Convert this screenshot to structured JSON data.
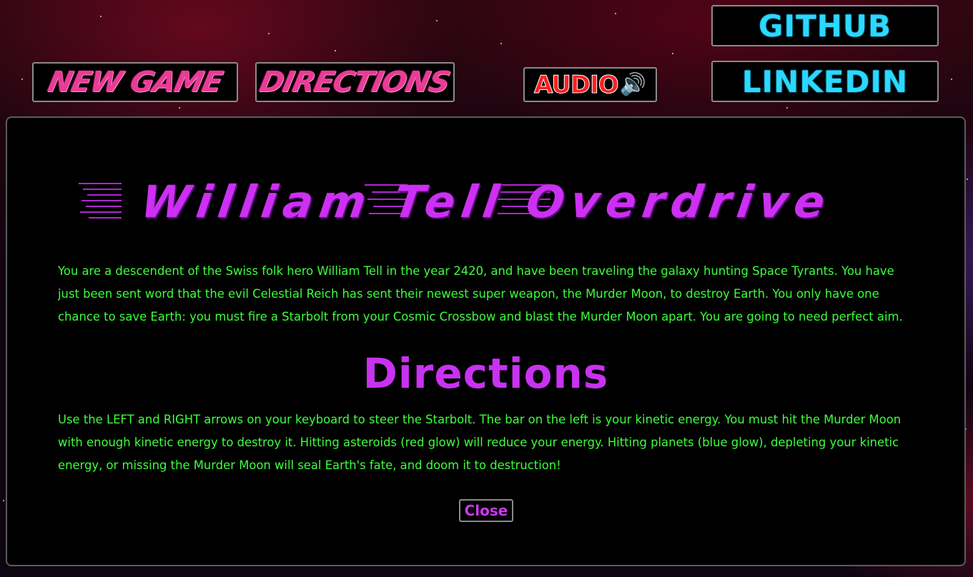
{
  "nav": {
    "new_game_label": "NEW GAME",
    "directions_label": "DIRECTIONS",
    "audio_label": "AUDIO",
    "audio_icon": "speaker-icon",
    "github_label": "GITHUB",
    "linkedin_label": "LINKEDIN"
  },
  "modal": {
    "title": "William Tell Overdrive",
    "story": "You are a descendent of the Swiss folk hero William Tell in the year 2420, and have been traveling the galaxy hunting Space Tyrants. You have just been sent word that the evil Celestial Reich has sent their newest super weapon, the Murder Moon, to destroy Earth. You only have one chance to save Earth: you must fire a Starbolt from your Cosmic Crossbow and blast the Murder Moon apart. You are going to need perfect aim.",
    "directions_heading": "Directions",
    "directions_text": "Use the LEFT and RIGHT arrows on your keyboard to steer the Starbolt. The bar on the left is your kinetic energy. You must hit the Murder Moon with enough kinetic energy to destroy it. Hitting asteroids (red glow) will reduce your energy. Hitting planets (blue glow), depleting your kinetic energy, or missing the Murder Moon will seal Earth's fate, and doom it to destruction!",
    "close_label": "Close"
  },
  "colors": {
    "title": "#cc30f2",
    "body_text": "#3cff3c",
    "pink_buttons": "#e83c97",
    "cyan_buttons": "#2bd8ff",
    "audio": "#ff1f1f"
  }
}
